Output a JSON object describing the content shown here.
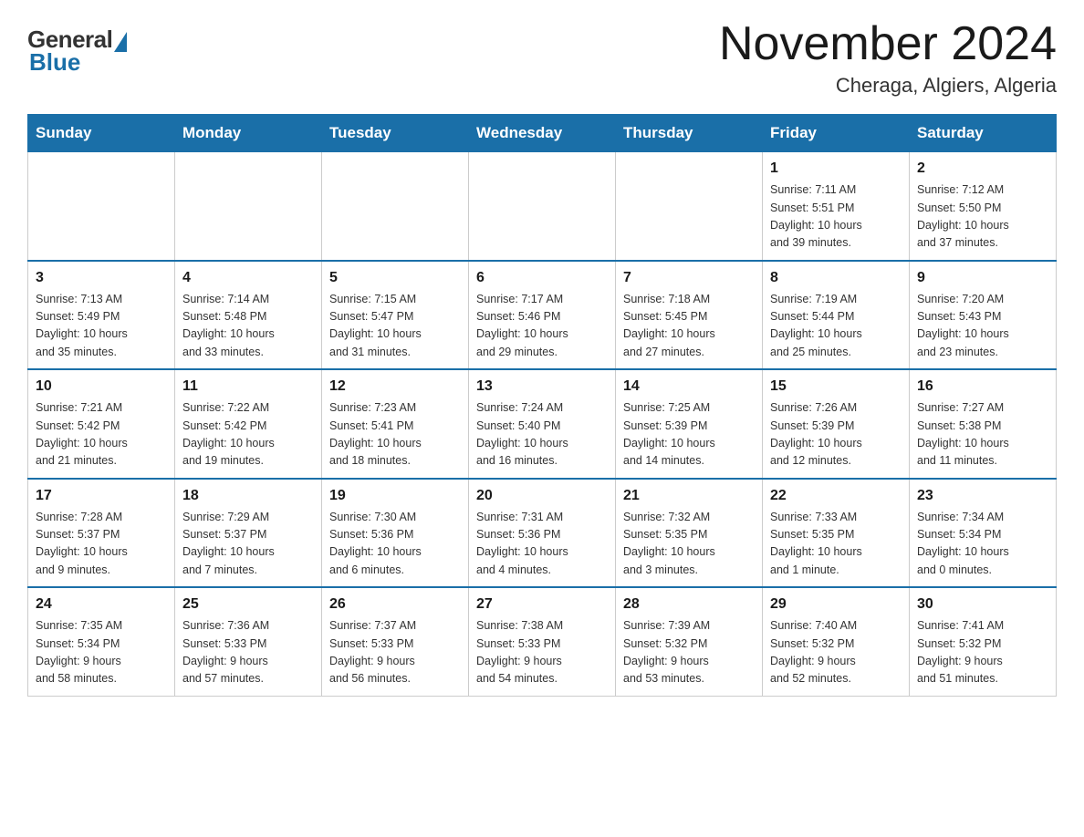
{
  "header": {
    "logo": {
      "general": "General",
      "blue": "Blue"
    },
    "title": "November 2024",
    "subtitle": "Cheraga, Algiers, Algeria"
  },
  "weekdays": [
    "Sunday",
    "Monday",
    "Tuesday",
    "Wednesday",
    "Thursday",
    "Friday",
    "Saturday"
  ],
  "weeks": [
    [
      {
        "day": "",
        "info": ""
      },
      {
        "day": "",
        "info": ""
      },
      {
        "day": "",
        "info": ""
      },
      {
        "day": "",
        "info": ""
      },
      {
        "day": "",
        "info": ""
      },
      {
        "day": "1",
        "info": "Sunrise: 7:11 AM\nSunset: 5:51 PM\nDaylight: 10 hours\nand 39 minutes."
      },
      {
        "day": "2",
        "info": "Sunrise: 7:12 AM\nSunset: 5:50 PM\nDaylight: 10 hours\nand 37 minutes."
      }
    ],
    [
      {
        "day": "3",
        "info": "Sunrise: 7:13 AM\nSunset: 5:49 PM\nDaylight: 10 hours\nand 35 minutes."
      },
      {
        "day": "4",
        "info": "Sunrise: 7:14 AM\nSunset: 5:48 PM\nDaylight: 10 hours\nand 33 minutes."
      },
      {
        "day": "5",
        "info": "Sunrise: 7:15 AM\nSunset: 5:47 PM\nDaylight: 10 hours\nand 31 minutes."
      },
      {
        "day": "6",
        "info": "Sunrise: 7:17 AM\nSunset: 5:46 PM\nDaylight: 10 hours\nand 29 minutes."
      },
      {
        "day": "7",
        "info": "Sunrise: 7:18 AM\nSunset: 5:45 PM\nDaylight: 10 hours\nand 27 minutes."
      },
      {
        "day": "8",
        "info": "Sunrise: 7:19 AM\nSunset: 5:44 PM\nDaylight: 10 hours\nand 25 minutes."
      },
      {
        "day": "9",
        "info": "Sunrise: 7:20 AM\nSunset: 5:43 PM\nDaylight: 10 hours\nand 23 minutes."
      }
    ],
    [
      {
        "day": "10",
        "info": "Sunrise: 7:21 AM\nSunset: 5:42 PM\nDaylight: 10 hours\nand 21 minutes."
      },
      {
        "day": "11",
        "info": "Sunrise: 7:22 AM\nSunset: 5:42 PM\nDaylight: 10 hours\nand 19 minutes."
      },
      {
        "day": "12",
        "info": "Sunrise: 7:23 AM\nSunset: 5:41 PM\nDaylight: 10 hours\nand 18 minutes."
      },
      {
        "day": "13",
        "info": "Sunrise: 7:24 AM\nSunset: 5:40 PM\nDaylight: 10 hours\nand 16 minutes."
      },
      {
        "day": "14",
        "info": "Sunrise: 7:25 AM\nSunset: 5:39 PM\nDaylight: 10 hours\nand 14 minutes."
      },
      {
        "day": "15",
        "info": "Sunrise: 7:26 AM\nSunset: 5:39 PM\nDaylight: 10 hours\nand 12 minutes."
      },
      {
        "day": "16",
        "info": "Sunrise: 7:27 AM\nSunset: 5:38 PM\nDaylight: 10 hours\nand 11 minutes."
      }
    ],
    [
      {
        "day": "17",
        "info": "Sunrise: 7:28 AM\nSunset: 5:37 PM\nDaylight: 10 hours\nand 9 minutes."
      },
      {
        "day": "18",
        "info": "Sunrise: 7:29 AM\nSunset: 5:37 PM\nDaylight: 10 hours\nand 7 minutes."
      },
      {
        "day": "19",
        "info": "Sunrise: 7:30 AM\nSunset: 5:36 PM\nDaylight: 10 hours\nand 6 minutes."
      },
      {
        "day": "20",
        "info": "Sunrise: 7:31 AM\nSunset: 5:36 PM\nDaylight: 10 hours\nand 4 minutes."
      },
      {
        "day": "21",
        "info": "Sunrise: 7:32 AM\nSunset: 5:35 PM\nDaylight: 10 hours\nand 3 minutes."
      },
      {
        "day": "22",
        "info": "Sunrise: 7:33 AM\nSunset: 5:35 PM\nDaylight: 10 hours\nand 1 minute."
      },
      {
        "day": "23",
        "info": "Sunrise: 7:34 AM\nSunset: 5:34 PM\nDaylight: 10 hours\nand 0 minutes."
      }
    ],
    [
      {
        "day": "24",
        "info": "Sunrise: 7:35 AM\nSunset: 5:34 PM\nDaylight: 9 hours\nand 58 minutes."
      },
      {
        "day": "25",
        "info": "Sunrise: 7:36 AM\nSunset: 5:33 PM\nDaylight: 9 hours\nand 57 minutes."
      },
      {
        "day": "26",
        "info": "Sunrise: 7:37 AM\nSunset: 5:33 PM\nDaylight: 9 hours\nand 56 minutes."
      },
      {
        "day": "27",
        "info": "Sunrise: 7:38 AM\nSunset: 5:33 PM\nDaylight: 9 hours\nand 54 minutes."
      },
      {
        "day": "28",
        "info": "Sunrise: 7:39 AM\nSunset: 5:32 PM\nDaylight: 9 hours\nand 53 minutes."
      },
      {
        "day": "29",
        "info": "Sunrise: 7:40 AM\nSunset: 5:32 PM\nDaylight: 9 hours\nand 52 minutes."
      },
      {
        "day": "30",
        "info": "Sunrise: 7:41 AM\nSunset: 5:32 PM\nDaylight: 9 hours\nand 51 minutes."
      }
    ]
  ]
}
